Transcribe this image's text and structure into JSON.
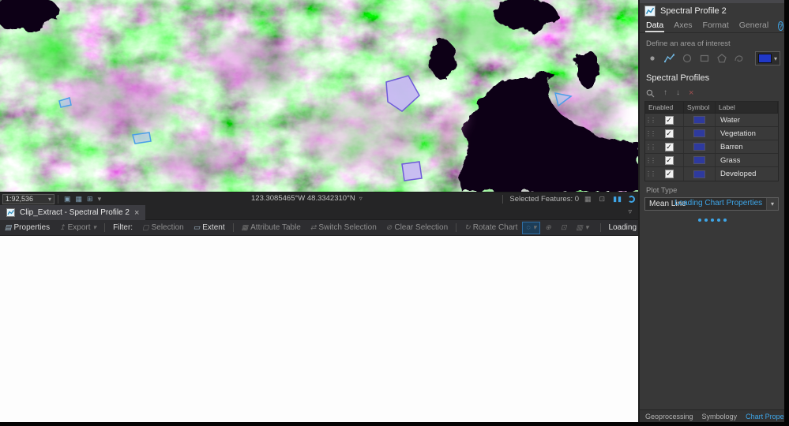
{
  "colors": {
    "accent": "#3ea6e8",
    "symbol-blue": "#2e3a9e",
    "swatch-blue": "#2038c8"
  },
  "icons": {
    "dropdown": "▾",
    "caret-down": "▿",
    "close": "×",
    "check": "✓",
    "grip": "⋮⋮",
    "help": "?",
    "properties": "▤",
    "export": "↥",
    "selection": "▢",
    "extent": "▭",
    "attribute_table": "▦",
    "switch_selection": "⇄",
    "clear_selection": "⊘",
    "rotate_chart": "↻",
    "lasso": "◌",
    "zoom": "⊕",
    "expand": "⊡",
    "panel_menu": "▥",
    "grid1": "▣",
    "grid2": "▦",
    "grid3": "⊞",
    "pause": "▮▮",
    "refresh": "↻",
    "up": "↑",
    "down": "↓"
  },
  "map": {
    "scale": "1:92,536",
    "coordinates": "123.3085465°W 48.3342310°N",
    "selected_features": "Selected Features: 0"
  },
  "chart_panel": {
    "tab_title": "Clip_Extract - Spectral Profile 2",
    "toolbar": {
      "properties": "Properties",
      "export": "Export",
      "filter": "Filter:",
      "selection": "Selection",
      "extent": "Extent",
      "attribute_table": "Attribute Table",
      "switch_selection": "Switch Selection",
      "clear_selection": "Clear Selection",
      "rotate_chart": "Rotate Chart",
      "loading": "Loading"
    }
  },
  "panel": {
    "title": "Spectral Profile 2",
    "tabs": {
      "data": "Data",
      "axes": "Axes",
      "format": "Format",
      "general": "General"
    },
    "aoi_label": "Define an area of interest",
    "profiles_title": "Spectral Profiles",
    "table": {
      "headers": {
        "enabled": "Enabled",
        "symbol": "Symbol",
        "label": "Label"
      },
      "rows": [
        {
          "label": "Water"
        },
        {
          "label": "Vegetation"
        },
        {
          "label": "Barren"
        },
        {
          "label": "Grass"
        },
        {
          "label": "Developed"
        }
      ]
    },
    "plot_type_label": "Plot Type",
    "plot_type_value": "Mean Line",
    "loading_text": "Loading Chart Properties"
  },
  "dock_tabs": {
    "geoprocessing": "Geoprocessing",
    "symbology": "Symbology",
    "chart_properties": "Chart Properties"
  }
}
